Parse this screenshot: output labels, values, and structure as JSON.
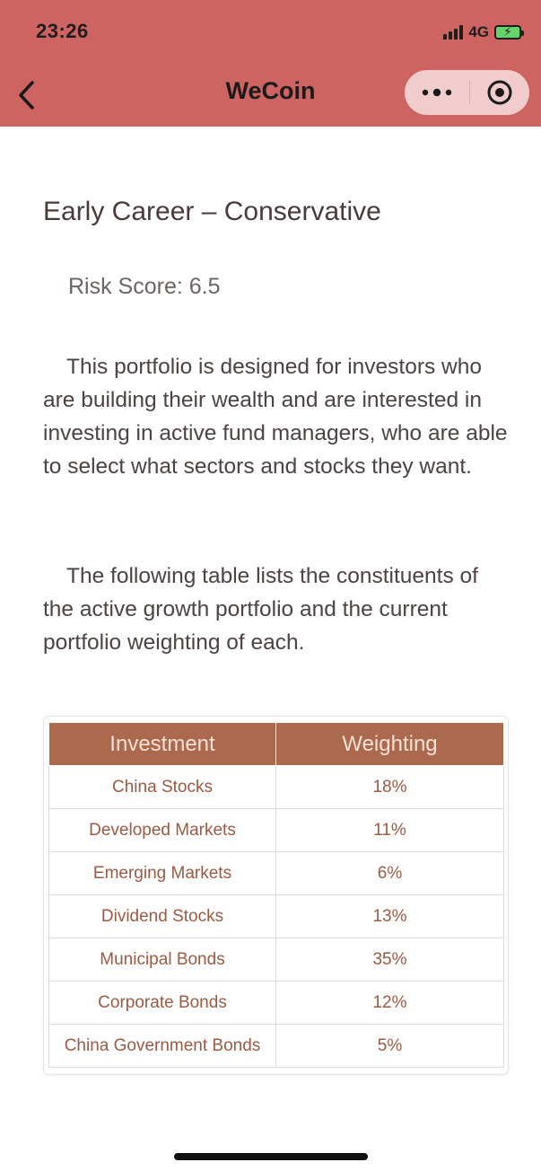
{
  "status_bar": {
    "time": "23:26",
    "network": "4G"
  },
  "nav": {
    "title": "WeCoin",
    "back_icon": "chevron-left-icon",
    "more_icon": "more-dots-icon",
    "close_icon": "target-circle-icon"
  },
  "content": {
    "title": "Early Career – Conservative",
    "risk_score": "Risk Score: 6.5",
    "paragraph1": "This portfolio is designed for investors who are building their wealth and are interested in investing in active fund managers, who are able to select what sectors and stocks they want.",
    "paragraph2": "The following table lists the constituents of the active growth portfolio and the current portfolio weighting of each."
  },
  "table": {
    "headers": [
      "Investment",
      "Weighting"
    ],
    "rows": [
      {
        "investment": "China Stocks",
        "weighting": "18%"
      },
      {
        "investment": "Developed Markets",
        "weighting": "11%"
      },
      {
        "investment": "Emerging Markets",
        "weighting": "6%"
      },
      {
        "investment": "Dividend Stocks",
        "weighting": "13%"
      },
      {
        "investment": "Municipal Bonds",
        "weighting": "35%"
      },
      {
        "investment": "Corporate Bonds",
        "weighting": "12%"
      },
      {
        "investment": "China Government Bonds",
        "weighting": "5%"
      }
    ]
  },
  "colors": {
    "header_bg": "#cd6462",
    "table_header_bg": "#ab6a4e",
    "table_text": "#9b5a44"
  }
}
